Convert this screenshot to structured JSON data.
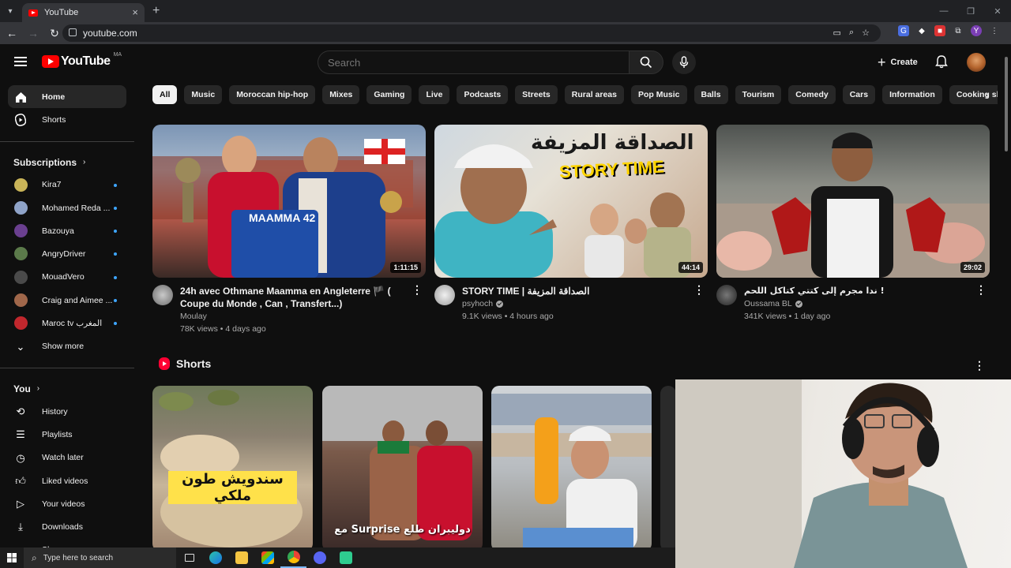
{
  "browser": {
    "tab_title": "YouTube",
    "url": "youtube.com",
    "profile_initial": "Y"
  },
  "header": {
    "logo_text": "YouTube",
    "country_code": "MA",
    "search_placeholder": "Search",
    "create_label": "Create"
  },
  "sidebar": {
    "main": [
      {
        "label": "Home",
        "icon": "home-icon",
        "active": true
      },
      {
        "label": "Shorts",
        "icon": "shorts-icon"
      }
    ],
    "subscriptions_title": "Subscriptions",
    "subscriptions": [
      {
        "label": "Kira7",
        "color": "#c9b458"
      },
      {
        "label": "Mohamed Reda ...",
        "color": "#8fa3c8"
      },
      {
        "label": "Bazouya",
        "color": "#6a3f8f"
      },
      {
        "label": "AngryDriver",
        "color": "#5b7a4a"
      },
      {
        "label": "MouadVero",
        "color": "#4a4a4a"
      },
      {
        "label": "Craig and Aimee ...",
        "color": "#a0674a"
      },
      {
        "label": "Maroc tv المغرب",
        "color": "#c1272d"
      }
    ],
    "show_more": "Show more",
    "you_title": "You",
    "you_items": [
      {
        "label": "History",
        "icon": "history-icon"
      },
      {
        "label": "Playlists",
        "icon": "playlists-icon"
      },
      {
        "label": "Watch later",
        "icon": "watch-later-icon"
      },
      {
        "label": "Liked videos",
        "icon": "like-icon"
      },
      {
        "label": "Your videos",
        "icon": "your-videos-icon"
      },
      {
        "label": "Downloads",
        "icon": "download-icon"
      },
      {
        "label": "Show more",
        "icon": "chevron-down-icon"
      }
    ]
  },
  "chips": [
    "All",
    "Music",
    "Moroccan hip-hop",
    "Mixes",
    "Gaming",
    "Live",
    "Podcasts",
    "Streets",
    "Rural areas",
    "Pop Music",
    "Balls",
    "Tourism",
    "Comedy",
    "Cars",
    "Information",
    "Cooking shows"
  ],
  "videos": [
    {
      "title": "24h avec Othmane Maamma en Angleterre 🏴 ( Coupe du Monde , Can , Transfert...)",
      "channel": "Moulay",
      "stats": "78K views • 4 days ago",
      "duration": "1:11:15",
      "thumb_text": "MAAMMA 42"
    },
    {
      "title": "STORY TIME | الصداقة المزيفة",
      "channel": "psyhoch",
      "stats": "9.1K views • 4 hours ago",
      "duration": "44:14",
      "thumb_arabic": "الصداقة المزيفة",
      "thumb_en": "STORY TIME"
    },
    {
      "title": "! ندا مجرم إلى كتتي كتاكل اللحم",
      "channel": "Oussama BL",
      "stats": "341K views • 1 day ago",
      "duration": "29:02"
    }
  ],
  "shorts": {
    "title": "Shorts",
    "items": [
      {
        "caption": "سندويش طون ملكي"
      },
      {
        "caption": "دوليبران طلع Surprise مع"
      },
      {
        "caption": ""
      }
    ]
  },
  "taskbar": {
    "search_placeholder": "Type here to search"
  }
}
